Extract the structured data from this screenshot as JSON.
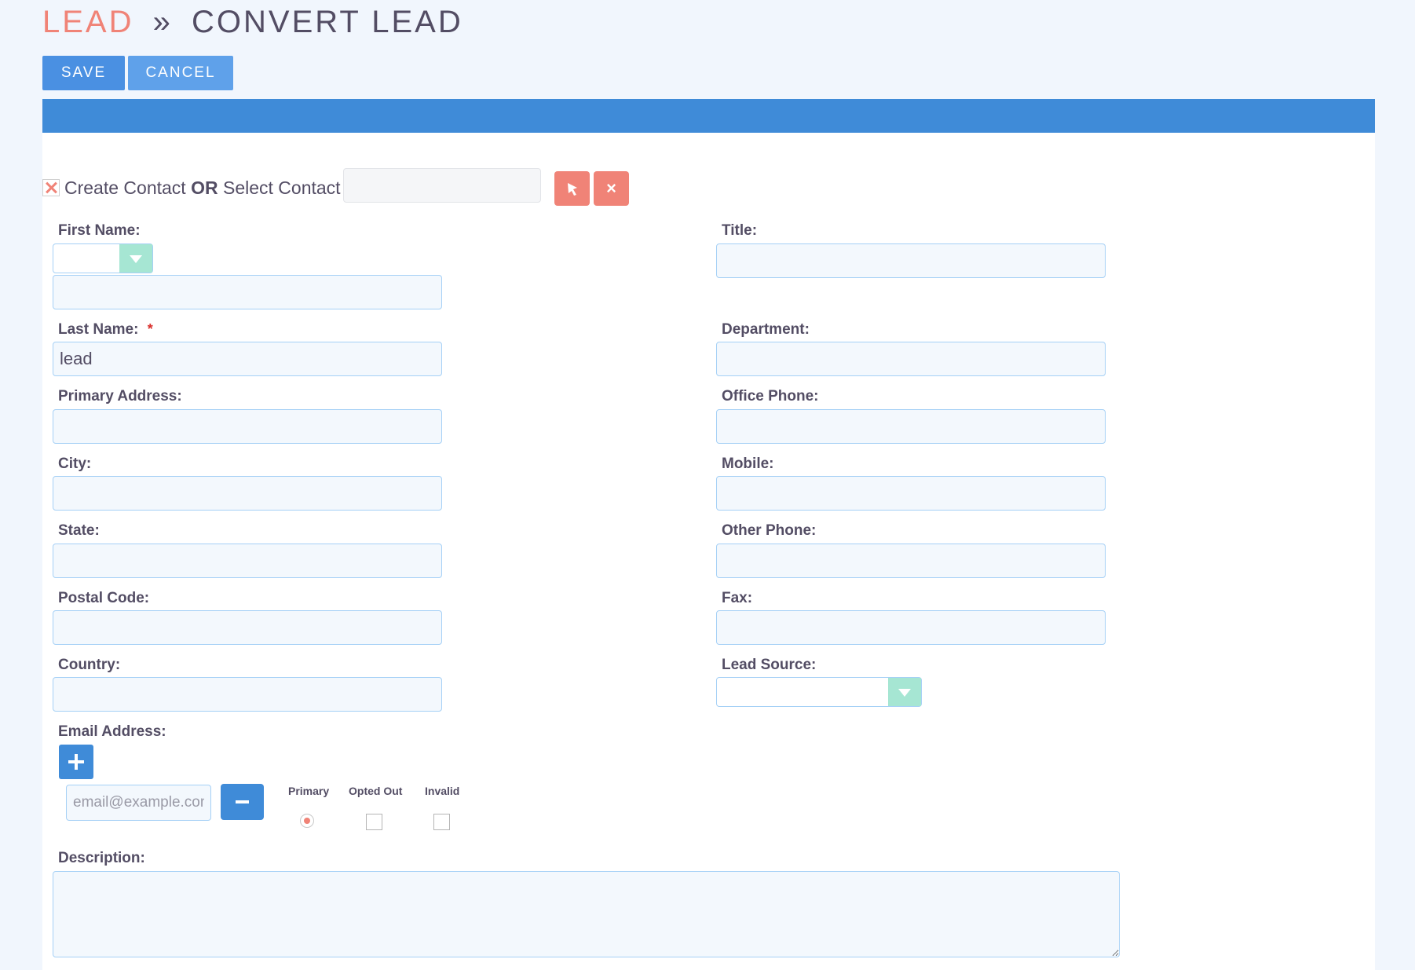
{
  "breadcrumb": {
    "module": "LEAD",
    "separator": "»",
    "action": "CONVERT LEAD"
  },
  "toolbar": {
    "save_label": "SAVE",
    "cancel_label": "CANCEL"
  },
  "create_contact": {
    "create_text": "Create Contact",
    "or_text": "OR",
    "select_text": "Select Contact",
    "required_mark": "*",
    "select_value": ""
  },
  "fields": {
    "first_name": {
      "label": "First Name:",
      "salutation": "",
      "value": ""
    },
    "last_name": {
      "label": "Last Name:",
      "required_mark": "*",
      "value": "lead"
    },
    "primary_address": {
      "label": "Primary Address:",
      "value": ""
    },
    "city": {
      "label": "City:",
      "value": ""
    },
    "state": {
      "label": "State:",
      "value": ""
    },
    "postal_code": {
      "label": "Postal Code:",
      "value": ""
    },
    "country": {
      "label": "Country:",
      "value": ""
    },
    "title": {
      "label": "Title:",
      "value": ""
    },
    "department": {
      "label": "Department:",
      "value": ""
    },
    "office_phone": {
      "label": "Office Phone:",
      "value": ""
    },
    "mobile": {
      "label": "Mobile:",
      "value": ""
    },
    "other_phone": {
      "label": "Other Phone:",
      "value": ""
    },
    "fax": {
      "label": "Fax:",
      "value": ""
    },
    "lead_source": {
      "label": "Lead Source:",
      "value": ""
    },
    "email": {
      "label": "Email Address:",
      "placeholder": "email@example.com",
      "value": "",
      "primary_label": "Primary",
      "opted_out_label": "Opted Out",
      "invalid_label": "Invalid",
      "primary_checked": true,
      "opted_out_checked": false,
      "invalid_checked": false
    },
    "description": {
      "label": "Description:",
      "value": ""
    }
  },
  "colors": {
    "accent": "#f08377",
    "panel_header": "#3f8bd8",
    "button": "#4a90e2",
    "dropdown_arrow": "#a6e6d3",
    "input_border": "#a5d0f6"
  },
  "icons": {
    "create_checkbox": "x-mark-icon",
    "select_button": "cursor-arrow-icon",
    "clear_button": "close-icon",
    "add_email": "plus-icon",
    "remove_email": "minus-icon",
    "dropdown": "chevron-down-icon"
  }
}
